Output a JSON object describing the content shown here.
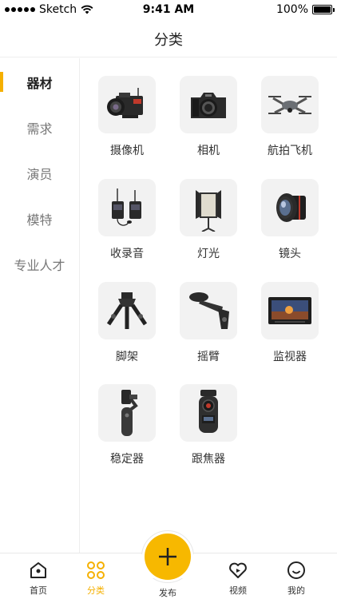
{
  "status_bar": {
    "carrier": "Sketch",
    "time": "9:41 AM",
    "battery": "100%"
  },
  "nav": {
    "title": "分类"
  },
  "sidebar": {
    "items": [
      {
        "label": "器材",
        "active": true
      },
      {
        "label": "需求",
        "active": false
      },
      {
        "label": "演员",
        "active": false
      },
      {
        "label": "模特",
        "active": false
      },
      {
        "label": "专业人才",
        "active": false
      }
    ]
  },
  "categories": [
    {
      "label": "摄像机",
      "icon": "cinema-camera-icon"
    },
    {
      "label": "相机",
      "icon": "dslr-camera-icon"
    },
    {
      "label": "航拍飞机",
      "icon": "drone-icon"
    },
    {
      "label": "收录音",
      "icon": "wireless-mic-icon"
    },
    {
      "label": "灯光",
      "icon": "led-light-icon"
    },
    {
      "label": "镜头",
      "icon": "lens-icon"
    },
    {
      "label": "脚架",
      "icon": "tripod-head-icon"
    },
    {
      "label": "摇臂",
      "icon": "crane-arm-icon"
    },
    {
      "label": "监视器",
      "icon": "monitor-icon"
    },
    {
      "label": "稳定器",
      "icon": "gimbal-icon"
    },
    {
      "label": "跟焦器",
      "icon": "follow-focus-icon"
    }
  ],
  "tab_bar": {
    "home": "首页",
    "category": "分类",
    "publish": "发布",
    "video": "视频",
    "mine": "我的"
  },
  "colors": {
    "accent": "#f5b000",
    "publish": "#f7b800",
    "thumb_bg": "#f2f2f2"
  }
}
